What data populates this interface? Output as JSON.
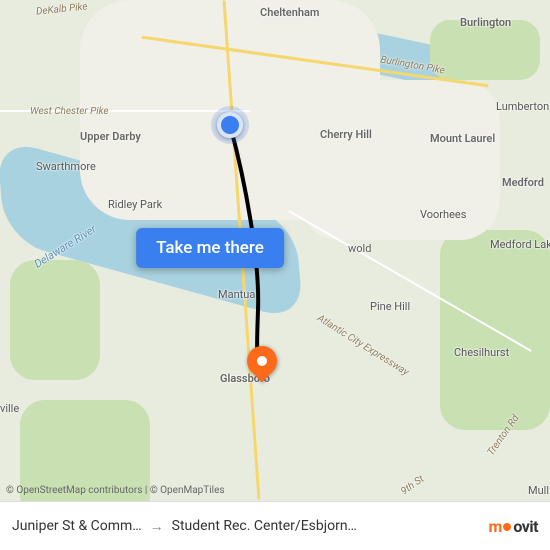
{
  "cta_label": "Take me there",
  "attribution": "© OpenStreetMap contributors | © OpenMapTiles",
  "footer": {
    "from": "Juniper St & Comm…",
    "to": "Student Rec. Center/Esbjorn…",
    "logo_text": "moovit"
  },
  "labels": {
    "cheltenham": "Cheltenham",
    "burlington": "Burlington",
    "upper_darby": "Upper Darby",
    "swarthmore": "Swarthmore",
    "ridley_park": "Ridley Park",
    "cherry_hill": "Cherry Hill",
    "mount_laurel": "Mount Laurel",
    "lumberton": "Lumberton",
    "medford": "Medford",
    "voorhees": "Voorhees",
    "medford_lakes": "Medford Lakes",
    "haddonfield": "wold",
    "mantua": "Mantua",
    "pine_hill": "Pine Hill",
    "glassboro": "Glassboro",
    "chesilhurst": "Chesilhurst",
    "ville": "ville",
    "mull": "Mull",
    "delaware_river": "Delaware River",
    "dekalb_pike": "DeKalb Pike",
    "west_chester_pike": "West Chester Pike",
    "burlington_pike": "Burlington Pike",
    "atlantic_city_expy": "Atlantic City Expressway",
    "trenton_rd": "Trenton Rd",
    "nineth_st": "9th St"
  },
  "colors": {
    "accent_blue": "#3a7ff0",
    "accent_orange": "#ff6a1a"
  }
}
